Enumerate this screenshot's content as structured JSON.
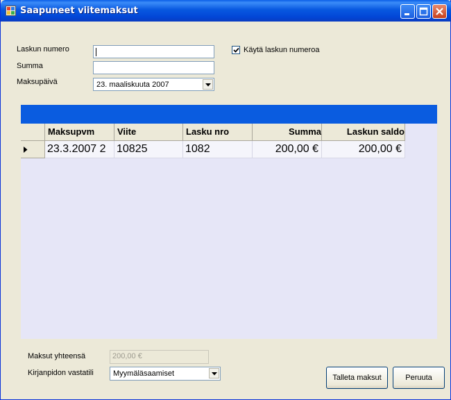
{
  "window": {
    "title": "Saapuneet viitemaksut"
  },
  "form": {
    "invoice_number_label": "Laskun numero",
    "invoice_number_value": "",
    "sum_label": "Summa",
    "sum_value": "",
    "payment_date_label": "Maksupäivä",
    "payment_date_value": "23. maaliskuuta 2007",
    "use_invoice_number_label": "Käytä laskun numeroa",
    "use_invoice_number_checked": true
  },
  "grid": {
    "columns": [
      "Maksupvm",
      "Viite",
      "Lasku nro",
      "Summa",
      "Laskun saldo"
    ],
    "rows": [
      [
        "23.3.2007 2",
        "10825",
        "1082",
        "200,00 €",
        "200,00 €"
      ]
    ]
  },
  "footer": {
    "total_label": "Maksut yhteensä",
    "total_value": "200,00 €",
    "account_label": "Kirjanpidon vastatili",
    "account_value": "Myymäläsaamiset",
    "save_label": "Talleta maksut",
    "cancel_label": "Peruuta"
  },
  "colors": {
    "titlebar": "#0858e0",
    "grid_caption": "#0a5ce0",
    "grid_background": "#e6e6f7",
    "form_background": "#ece9d8"
  }
}
